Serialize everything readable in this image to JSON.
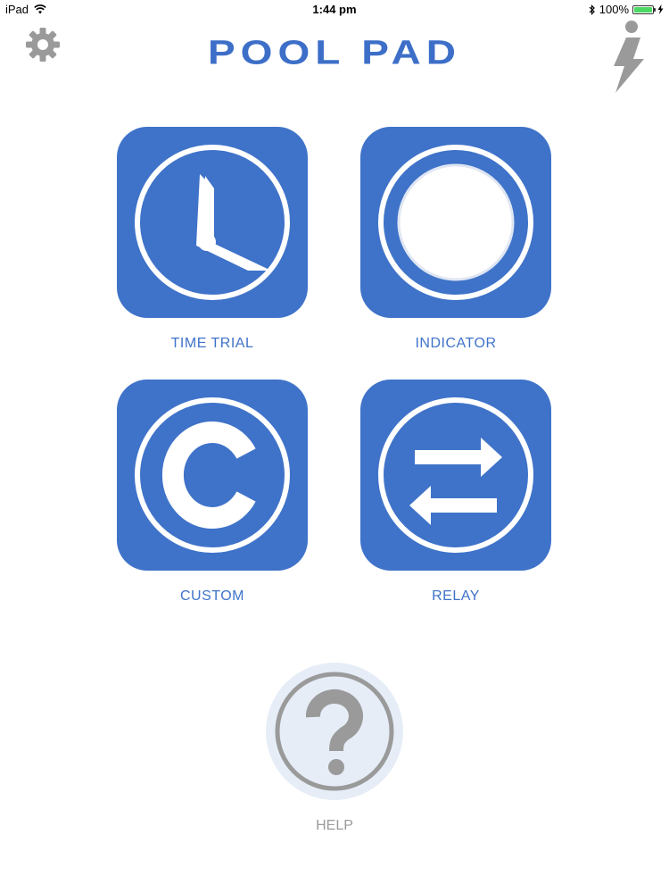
{
  "status_bar": {
    "device": "iPad",
    "time": "1:44 pm",
    "battery": "100%",
    "battery_level": 1.0
  },
  "header": {
    "title": "POOL PAD",
    "settings_icon": "gear-icon",
    "info_icon": "info-lightning-icon"
  },
  "modes": {
    "time_trial": {
      "label": "TIME TRIAL",
      "icon": "clock-icon"
    },
    "indicator": {
      "label": "INDICATOR",
      "icon": "circle-indicator-icon"
    },
    "custom": {
      "label": "CUSTOM",
      "icon": "letter-c-icon"
    },
    "relay": {
      "label": "RELAY",
      "icon": "exchange-arrows-icon"
    }
  },
  "help": {
    "label": "HELP",
    "icon": "question-mark-icon"
  },
  "colors": {
    "tile_blue": "#3f73c9",
    "title_blue": "#3d6fc8",
    "icon_gray": "#9a9a9a",
    "help_bg": "#e6edf7",
    "battery_green": "#4cd964"
  }
}
